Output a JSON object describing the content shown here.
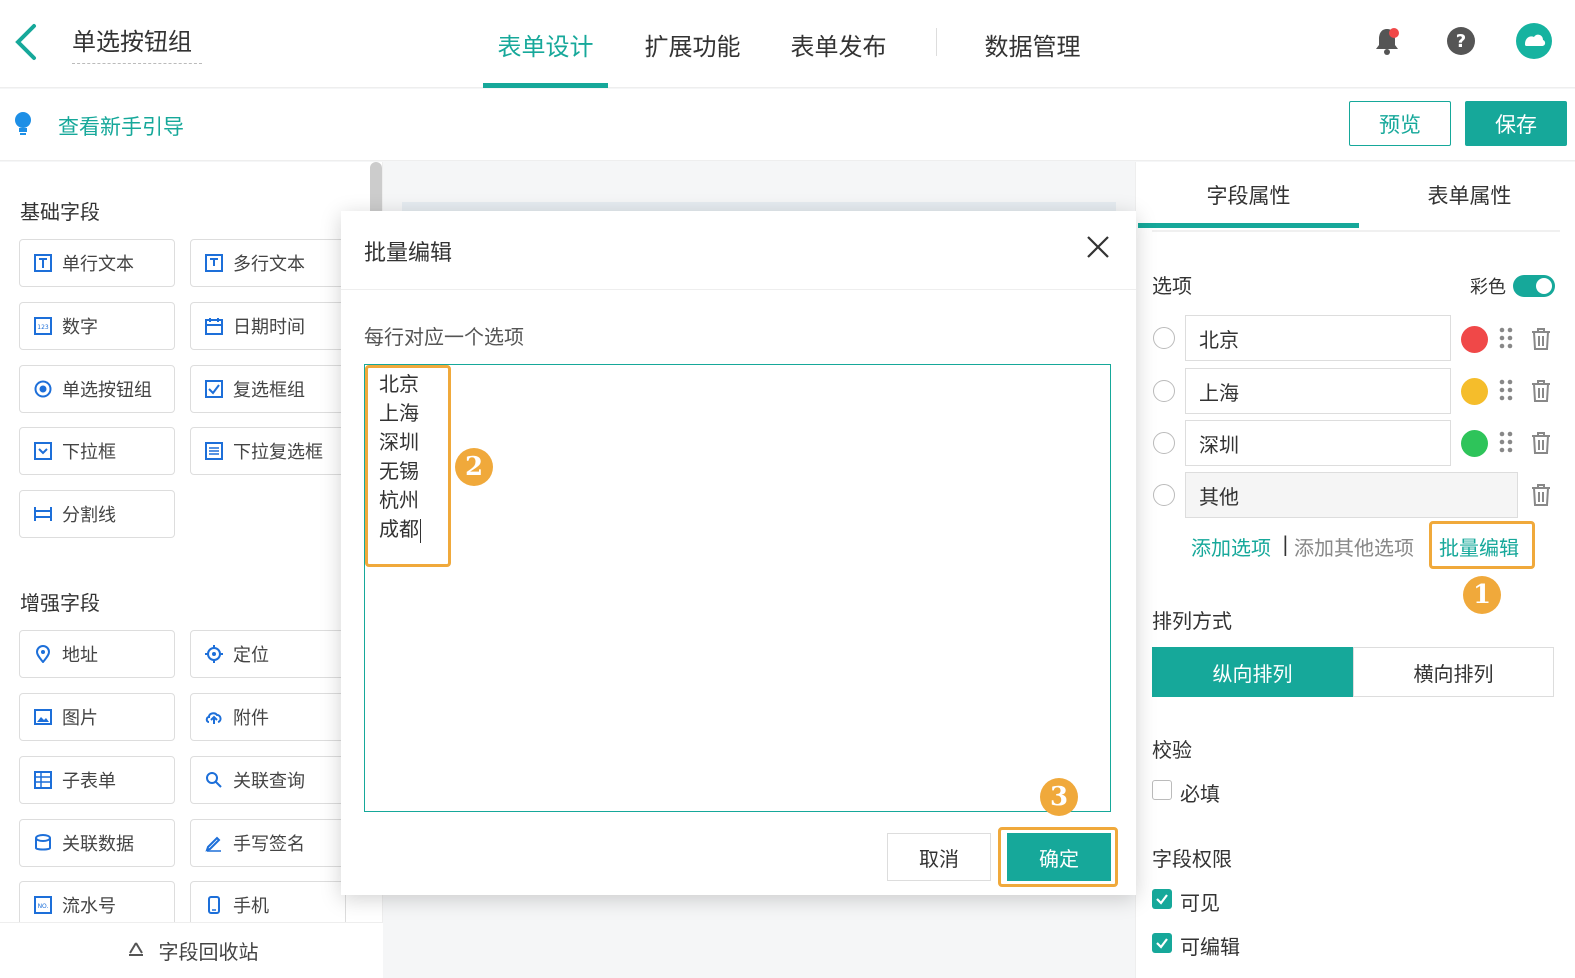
{
  "header": {
    "form_title": "单选按钮组",
    "tabs": [
      {
        "label": "表单设计",
        "active": true
      },
      {
        "label": "扩展功能",
        "active": false
      },
      {
        "label": "表单发布",
        "active": false
      },
      {
        "label": "数据管理",
        "active": false
      }
    ],
    "icons": [
      "bell-icon",
      "help-icon",
      "avatar"
    ],
    "accent_color": "#16a89a"
  },
  "subbar": {
    "guide_label": "查看新手引导",
    "preview_label": "预览",
    "save_label": "保存"
  },
  "left_panel": {
    "basic_title": "基础字段",
    "basic_fields": [
      "单行文本",
      "多行文本",
      "数字",
      "日期时间",
      "单选按钮组",
      "复选框组",
      "下拉框",
      "下拉复选框",
      "分割线"
    ],
    "enhanced_title": "增强字段",
    "enhanced_fields": [
      "地址",
      "定位",
      "图片",
      "附件",
      "子表单",
      "关联查询",
      "关联数据",
      "手写签名",
      "流水号",
      "手机"
    ],
    "recycle_label": "字段回收站"
  },
  "right_panel": {
    "tabs": [
      {
        "label": "字段属性",
        "active": true
      },
      {
        "label": "表单属性",
        "active": false
      }
    ],
    "options_label": "选项",
    "color_toggle_label": "彩色",
    "color_toggle_on": true,
    "options": [
      {
        "label": "北京",
        "color": "#f04848"
      },
      {
        "label": "上海",
        "color": "#f5bd2b"
      },
      {
        "label": "深圳",
        "color": "#2ec45a"
      }
    ],
    "other_option": "其他",
    "add_option": "添加选项",
    "separator": "|",
    "add_other_option": "添加其他选项",
    "batch_edit": "批量编辑",
    "layout_label": "排列方式",
    "layout_vertical": "纵向排列",
    "layout_horizontal": "横向排列",
    "validation_label": "校验",
    "required_label": "必填",
    "required_checked": false,
    "permission_label": "字段权限",
    "visible_label": "可见",
    "visible_checked": true,
    "editable_label": "可编辑",
    "editable_checked": true
  },
  "modal": {
    "title": "批量编辑",
    "hint": "每行对应一个选项",
    "lines": [
      "北京",
      "上海",
      "深圳",
      "无锡",
      "杭州",
      "成都"
    ],
    "cancel_label": "取消",
    "ok_label": "确定"
  },
  "annotations": {
    "step1": "1",
    "step2": "2",
    "step3": "3",
    "highlight_color": "#f0a93b"
  }
}
